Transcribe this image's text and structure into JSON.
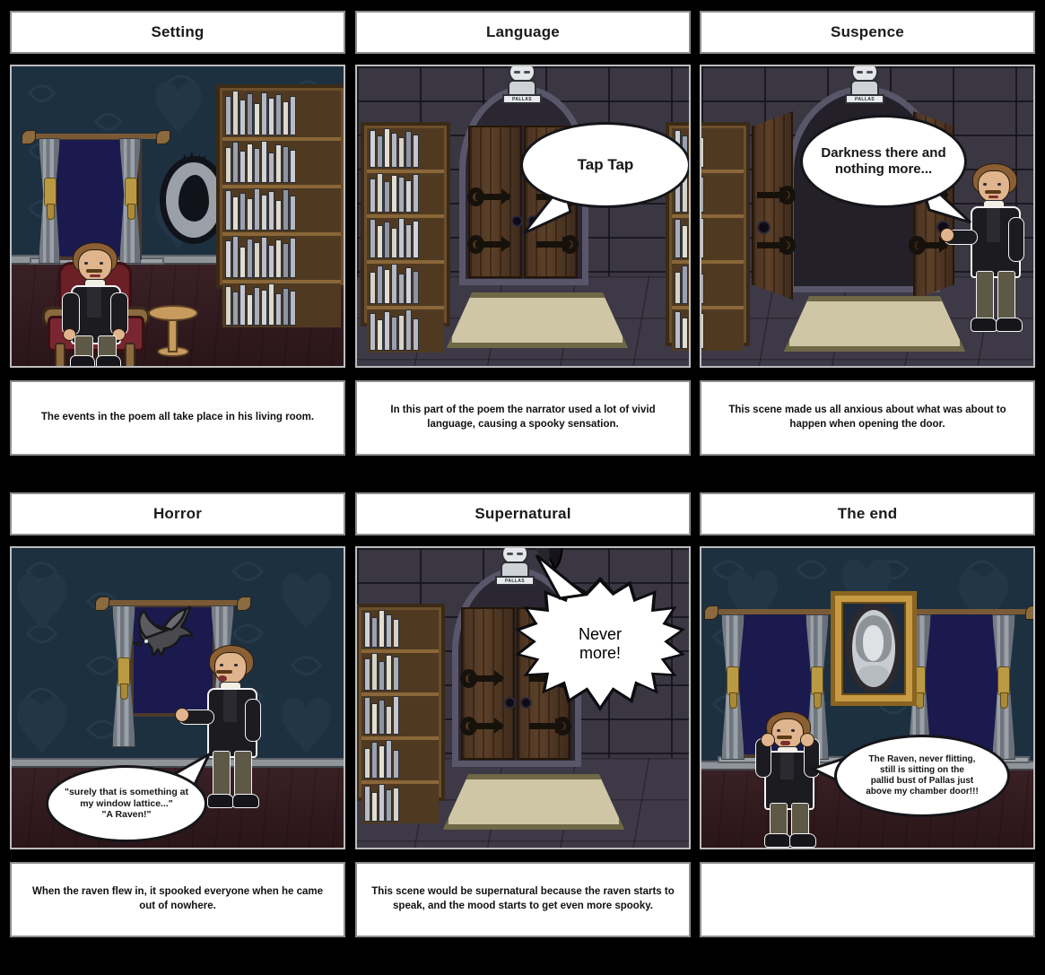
{
  "storyboard": {
    "panels": [
      {
        "id": "setting",
        "title": "Setting",
        "caption": "The events in the poem all take place in his living room.",
        "scene_type": "victorian-living-room",
        "speech": null
      },
      {
        "id": "language",
        "title": "Language",
        "caption": "In this part of the poem the narrator used a lot of vivid language, causing a spooky sensation.",
        "scene_type": "stone-chamber-closed-door",
        "speech": "Tap Tap",
        "bust_label": "PALLAS"
      },
      {
        "id": "suspence",
        "title": "Suspence",
        "caption": "This scene made us all anxious about what was about to happen when opening the door.",
        "scene_type": "stone-chamber-open-door",
        "speech": "Darkness there and nothing more...",
        "bust_label": "PALLAS"
      },
      {
        "id": "horror",
        "title": "Horror",
        "caption": "When the raven flew in, it spooked everyone when he came out of nowhere.",
        "scene_type": "victorian-window-raven",
        "speech_line1": "\"surely that is something at",
        "speech_line2": "my window lattice...\"",
        "speech_line3": "\"A Raven!\""
      },
      {
        "id": "supernatural",
        "title": "Supernatural",
        "caption": "This scene would be supernatural because the raven starts to speak, and the mood starts to get even more spooky.",
        "scene_type": "stone-chamber-raven-on-bust",
        "speech_line1": "Never",
        "speech_line2": "more!",
        "bust_label": "PALLAS"
      },
      {
        "id": "the-end",
        "title": "The end",
        "caption": "",
        "scene_type": "victorian-portrait-room",
        "speech_line1": "The Raven, never flitting,",
        "speech_line2": "still is sitting on the",
        "speech_line3": "pallid bust of Pallas just",
        "speech_line4": "above my chamber door!!!"
      }
    ],
    "colors": {
      "background": "#000000",
      "box_fill": "#ffffff",
      "box_border": "#8e8e8e",
      "text": "#1a1a1a",
      "room_wall": "#1d3040",
      "room_floor": "#32191e",
      "window_glass": "#1a1a4e",
      "stone_wall": "#3a3743",
      "stone_floor": "#3d3946",
      "door_wood": "#5c4029",
      "bookcase_wood": "#6d4f2c",
      "rug": "#cfc6a6",
      "frame_gold": "#c79a44",
      "chair_red": "#7a2630"
    }
  }
}
